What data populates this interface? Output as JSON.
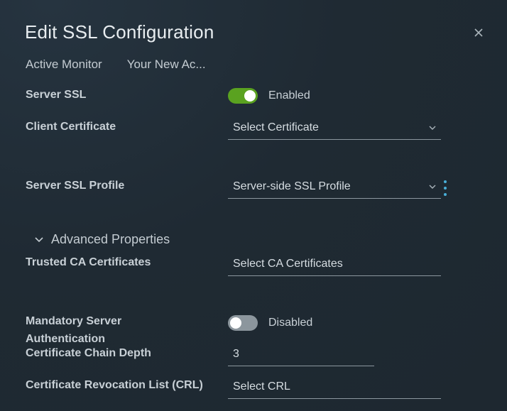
{
  "dialog": {
    "title": "Edit SSL Configuration",
    "tabs": [
      "Active Monitor",
      "Your New Ac..."
    ]
  },
  "server_ssl": {
    "label": "Server SSL",
    "toggle_state": true,
    "toggle_text": "Enabled"
  },
  "client_certificate": {
    "label": "Client Certificate",
    "value": "Select Certificate"
  },
  "server_ssl_profile": {
    "label": "Server SSL Profile",
    "value": "Server-side SSL Profile"
  },
  "advanced": {
    "label": "Advanced Properties"
  },
  "trusted_ca": {
    "label": "Trusted CA Certificates",
    "value": "Select CA Certificates"
  },
  "mandatory_auth": {
    "label_line1": "Mandatory Server",
    "label_line2": "Authentication",
    "toggle_state": false,
    "toggle_text": "Disabled"
  },
  "chain_depth": {
    "label": "Certificate Chain Depth",
    "value": "3"
  },
  "crl": {
    "label": "Certificate Revocation List (CRL)",
    "value": "Select CRL"
  },
  "colors": {
    "background": "#1f2a33",
    "toggle_on": "#5aa220",
    "toggle_off": "#8c969d",
    "accent": "#49afd9"
  },
  "icons": [
    "close-icon",
    "chevron-down-icon",
    "kebab-menu-icon"
  ]
}
